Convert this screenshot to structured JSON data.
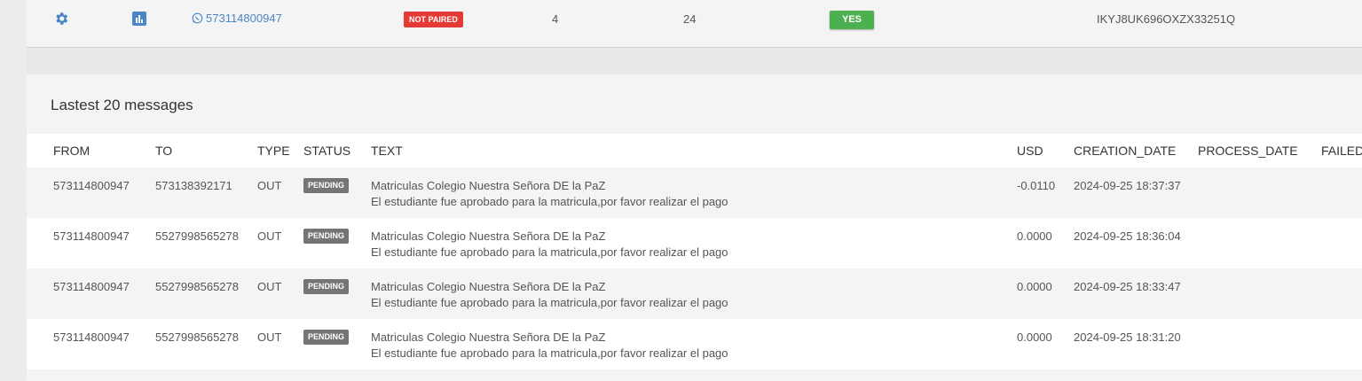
{
  "top_row": {
    "phone": "573114800947",
    "paired_status": "NOT PAIRED",
    "count_a": "4",
    "count_b": "24",
    "active": "YES",
    "token": "IKYJ8UK696OXZX33251Q",
    "icons": [
      "gear-icon",
      "chart-icon",
      "whatsapp-icon"
    ],
    "colors": {
      "link": "#4a86c7",
      "not_paired": "#e53935",
      "yes": "#4caf50"
    }
  },
  "messages": {
    "title": "Lastest 20 messages",
    "columns": [
      "FROM",
      "TO",
      "TYPE",
      "STATUS",
      "TEXT",
      "USD",
      "CREATION_DATE",
      "PROCESS_DATE",
      "FAILED_"
    ],
    "rows": [
      {
        "from": "573114800947",
        "to": "573138392171",
        "type": "OUT",
        "status": "PENDING",
        "text_line1": "Matriculas Colegio Nuestra Señora DE la PaZ",
        "text_line2": "El estudiante fue aprobado para la matricula,por favor realizar el pago",
        "usd": "-0.0110",
        "creation_date": "2024-09-25 18:37:37",
        "process_date": "",
        "failed": ""
      },
      {
        "from": "573114800947",
        "to": "5527998565278",
        "type": "OUT",
        "status": "PENDING",
        "text_line1": "Matriculas Colegio Nuestra Señora DE la PaZ",
        "text_line2": "El estudiante fue aprobado para la matricula,por favor realizar el pago",
        "usd": "0.0000",
        "creation_date": "2024-09-25 18:36:04",
        "process_date": "",
        "failed": ""
      },
      {
        "from": "573114800947",
        "to": "5527998565278",
        "type": "OUT",
        "status": "PENDING",
        "text_line1": "Matriculas Colegio Nuestra Señora DE la PaZ",
        "text_line2": "El estudiante fue aprobado para la matricula,por favor realizar el pago",
        "usd": "0.0000",
        "creation_date": "2024-09-25 18:33:47",
        "process_date": "",
        "failed": ""
      },
      {
        "from": "573114800947",
        "to": "5527998565278",
        "type": "OUT",
        "status": "PENDING",
        "text_line1": "Matriculas Colegio Nuestra Señora DE la PaZ",
        "text_line2": "El estudiante fue aprobado para la matricula,por favor realizar el pago",
        "usd": "0.0000",
        "creation_date": "2024-09-25 18:31:20",
        "process_date": "",
        "failed": ""
      }
    ],
    "colors": {
      "pending": "#757575"
    }
  }
}
